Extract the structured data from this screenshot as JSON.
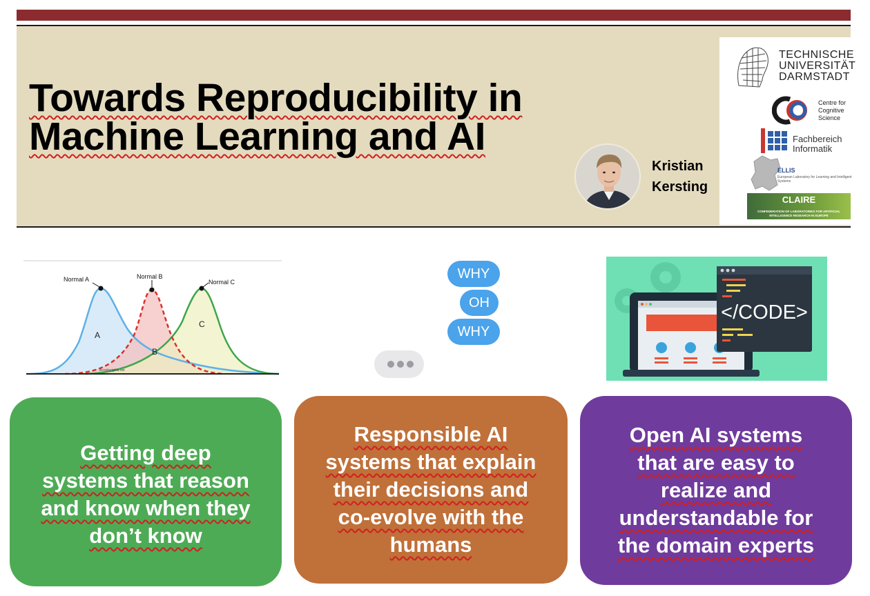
{
  "title": {
    "line1": "Towards Reproducibility in",
    "line2": "Machine Learning and AI"
  },
  "author": {
    "first": "Kristian",
    "last": "Kersting"
  },
  "logos": {
    "tu_line1": "TECHNISCHE",
    "tu_line2": "UNIVERSITÄT",
    "tu_line3": "DARMSTADT",
    "ccs_line1": "Centre for",
    "ccs_line2": "Cognitive",
    "ccs_line3": "Science",
    "inf_line1": "Fachbereich",
    "inf_line2": "Informatik",
    "ellis": "ELLIS",
    "ellis_sub": "European Laboratory for Learning and Intelligent Systems",
    "claire": "CLAIRE",
    "claire_sub": "CONFEDERATION OF LABORATORIES FOR ARTIFICIAL INTELLIGENCE RESEARCH IN EUROPE"
  },
  "chart": {
    "label_a": "Normal A",
    "label_b": "Normal B",
    "label_c": "Normal C",
    "region_a": "A",
    "region_b": "B",
    "region_c": "C",
    "watermark": "AcceInsights.net"
  },
  "chat": {
    "bubble1": "WHY",
    "bubble2": "OH",
    "bubble3": "WHY"
  },
  "code_illustration": {
    "code_text": "</CODE>"
  },
  "cards": [
    {
      "lines": [
        "Getting deep",
        "systems that reason",
        "and know when they",
        "don’t know"
      ],
      "color": "#4EAB55"
    },
    {
      "lines": [
        "Responsible AI",
        "systems that explain",
        "their decisions and",
        "co-evolve with the",
        "humans"
      ],
      "color": "#C07039"
    },
    {
      "lines": [
        "Open AI systems",
        "that are easy to",
        "realize and",
        "understandable for",
        "the domain experts"
      ],
      "color": "#6F3B9C"
    }
  ]
}
